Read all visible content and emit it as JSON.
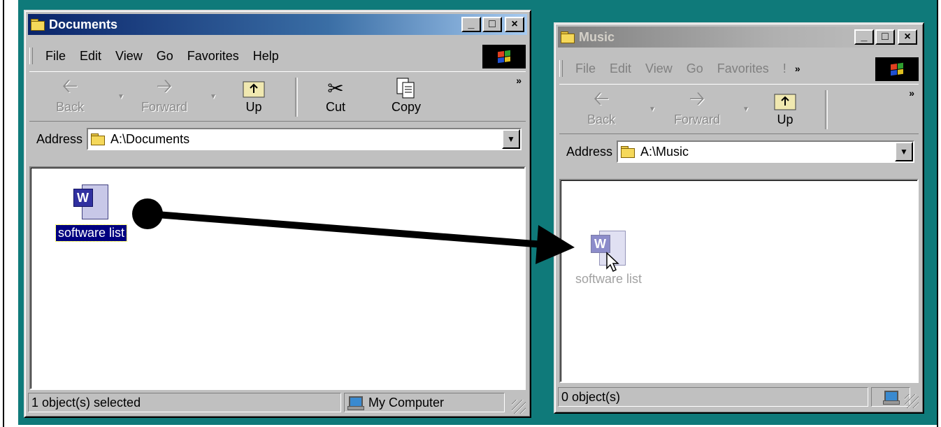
{
  "documents_window": {
    "title": "Documents",
    "title_buttons": {
      "minimize": "_",
      "maximize": "□",
      "close": "×"
    },
    "menu": [
      "File",
      "Edit",
      "View",
      "Go",
      "Favorites",
      "Help"
    ],
    "toolbar": {
      "back": "Back",
      "forward": "Forward",
      "up": "Up",
      "cut": "Cut",
      "copy": "Copy",
      "more": "»"
    },
    "address_label": "Address",
    "address_value": "A:\\Documents",
    "file_label": "software list",
    "status_left": "1 object(s) selected",
    "status_right": "My Computer"
  },
  "music_window": {
    "title": "Music",
    "title_buttons": {
      "minimize": "_",
      "maximize": "□",
      "close": "×"
    },
    "menu": [
      "File",
      "Edit",
      "View",
      "Go",
      "Favorites",
      "!"
    ],
    "menu_more": "»",
    "toolbar": {
      "back": "Back",
      "forward": "Forward",
      "up": "Up",
      "more": "»"
    },
    "address_label": "Address",
    "address_value": "A:\\Music",
    "file_label": "software list",
    "status_left": "0 object(s)"
  },
  "colors": {
    "desktop": "#0f7a7a",
    "active_title": "#0a246a",
    "inactive_title": "#808080",
    "selection": "#000080"
  },
  "icons": [
    "folder-icon",
    "windows-logo-icon",
    "back-arrow-icon",
    "forward-arrow-icon",
    "up-folder-icon",
    "scissors-icon",
    "copy-icon",
    "word-document-icon",
    "computer-icon",
    "mouse-cursor-icon",
    "drag-arrow"
  ]
}
